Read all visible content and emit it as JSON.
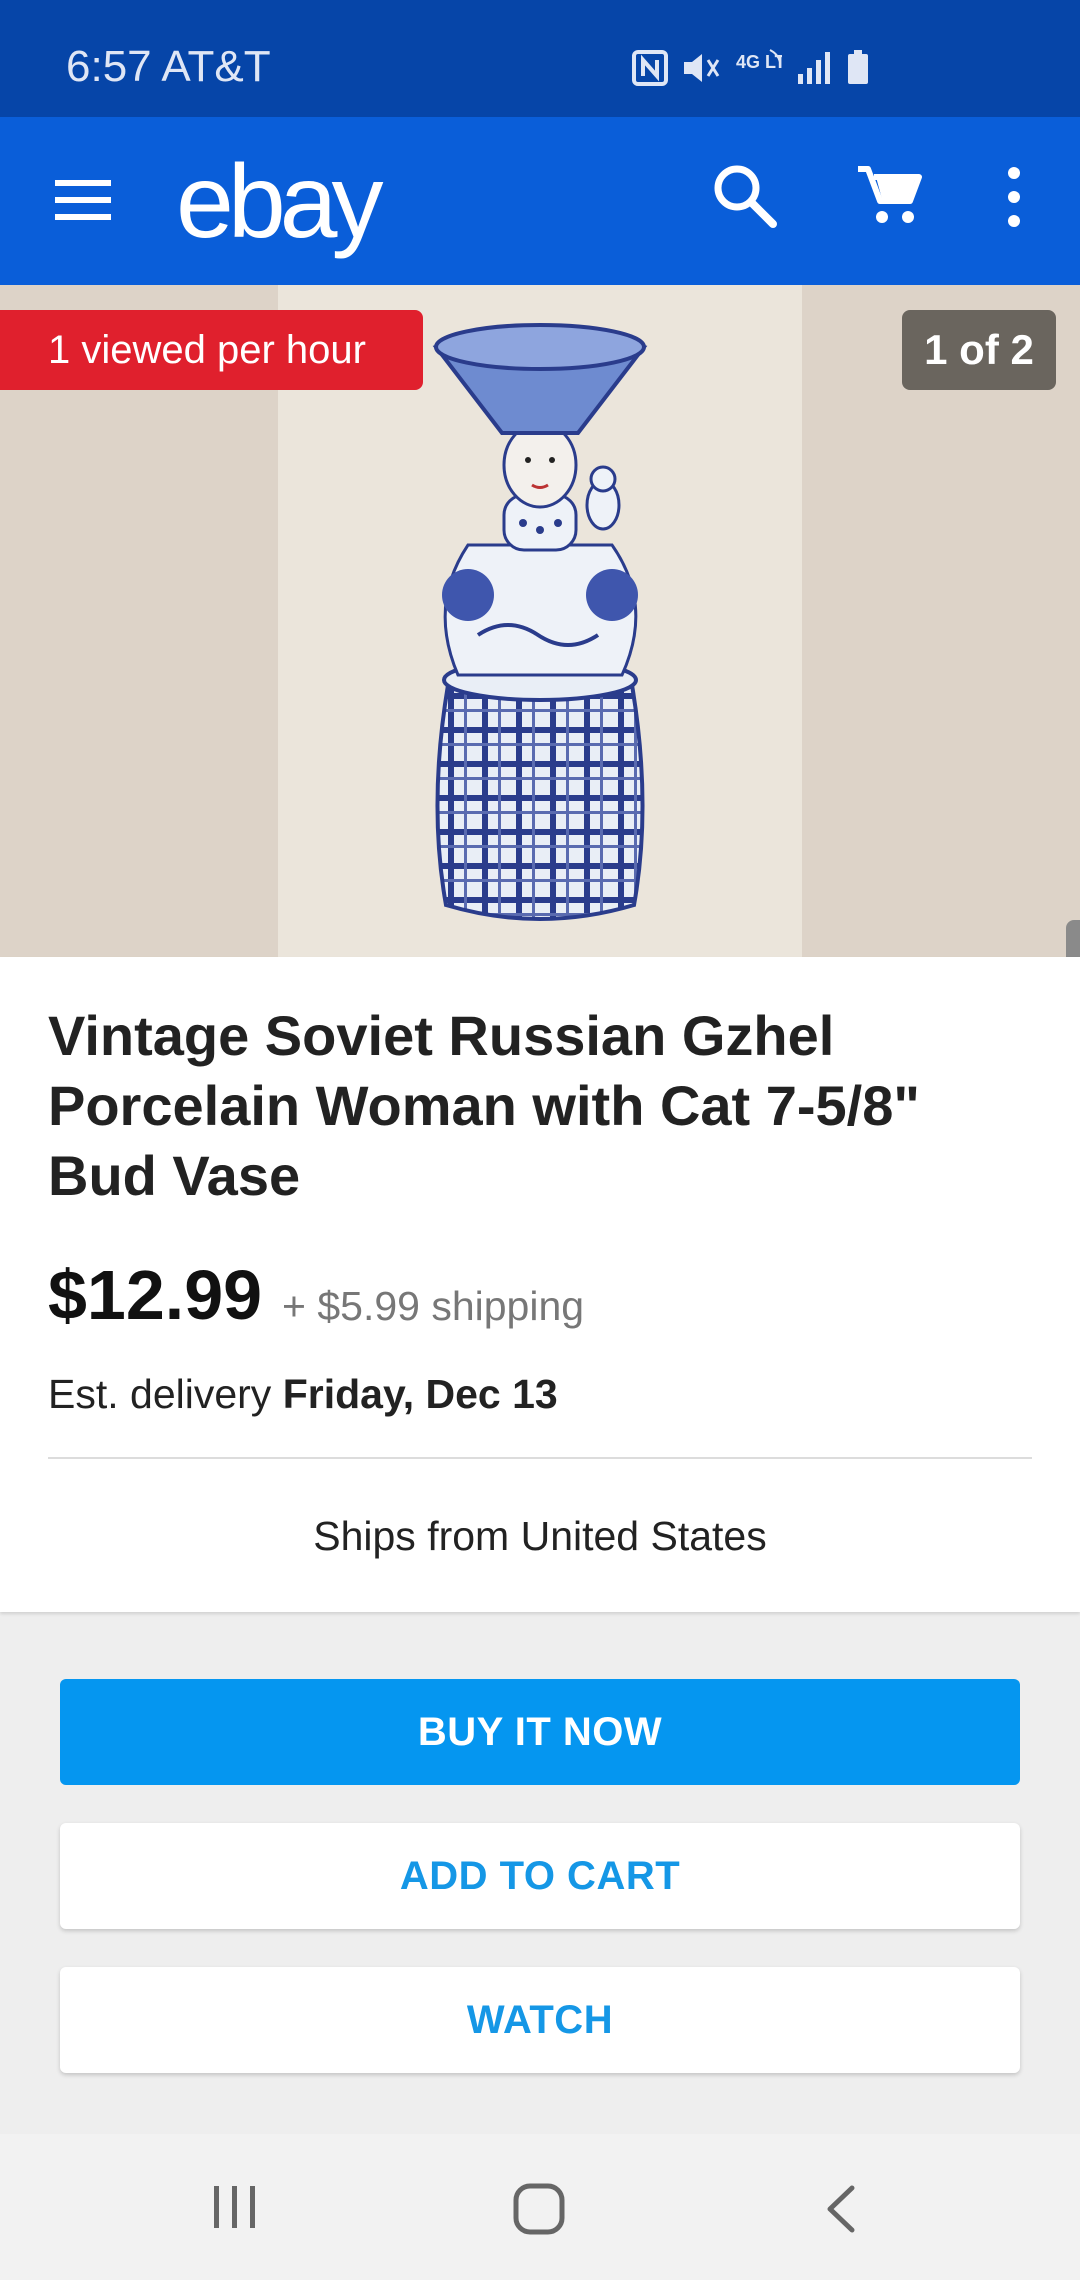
{
  "status_bar": {
    "time_carrier": "6:57 AT&T",
    "icons": [
      "nfc-icon",
      "mute-icon",
      "4g-lte-icon",
      "signal-icon",
      "battery-icon"
    ],
    "network_label": "4G LTE"
  },
  "app_bar": {
    "logo": "ebay",
    "icons": [
      "menu-icon",
      "search-icon",
      "cart-icon",
      "more-vert-icon"
    ],
    "color": "#0a5ed9"
  },
  "listing": {
    "views_badge": "1 viewed per hour",
    "image_counter": "1 of 2",
    "title": "Vintage Soviet Russian Gzhel Porcelain Woman with Cat 7-5/8\" Bud Vase",
    "price": "$12.99",
    "shipping": "+ $5.99 shipping",
    "delivery_prefix": "Est. delivery",
    "delivery_date": "Friday, Dec 13",
    "ships_from": "Ships from United States"
  },
  "actions": {
    "buy_now": "BUY IT NOW",
    "add_to_cart": "ADD TO CART",
    "watch": "WATCH"
  },
  "colors": {
    "status_bar": "#0645a8",
    "primary": "#0596f0",
    "badge_red": "#e0202d",
    "link_blue": "#1597e6"
  },
  "nav_bar": {
    "icons": [
      "recent-apps-icon",
      "home-icon",
      "back-icon"
    ]
  }
}
